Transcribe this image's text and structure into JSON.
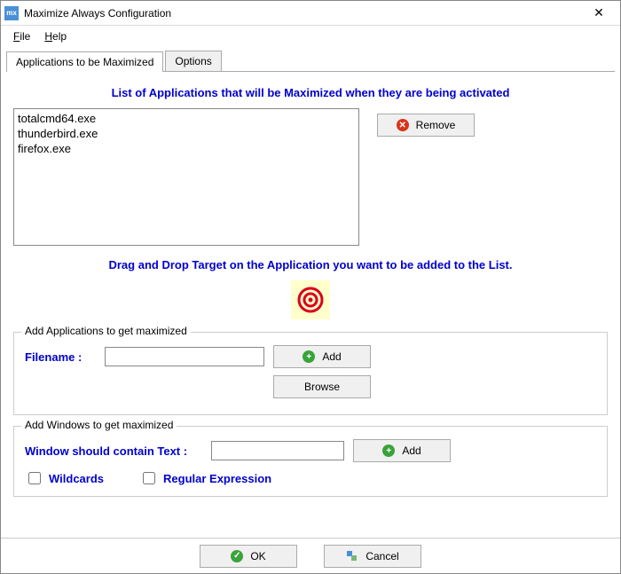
{
  "titlebar": {
    "title": "Maximize Always Configuration"
  },
  "menubar": {
    "file": "File",
    "help": "Help"
  },
  "tabs": {
    "applications": "Applications to be Maximized",
    "options": "Options"
  },
  "main": {
    "heading": "List of Applications that will be Maximized when they are being activated",
    "list": [
      "totalcmd64.exe",
      "thunderbird.exe",
      "firefox.exe"
    ],
    "remove_label": "Remove",
    "drag_hint": "Drag and Drop Target on the Application you want to be added to the List."
  },
  "group_apps": {
    "title": "Add Applications to get maximized",
    "filename_label": "Filename :",
    "filename_value": "",
    "add_label": "Add",
    "browse_label": "Browse"
  },
  "group_windows": {
    "title": "Add Windows to get maximized",
    "text_label": "Window should contain Text :",
    "text_value": "",
    "add_label": "Add",
    "wildcards_label": "Wildcards",
    "regex_label": "Regular Expression"
  },
  "footer": {
    "ok": "OK",
    "cancel": "Cancel"
  }
}
